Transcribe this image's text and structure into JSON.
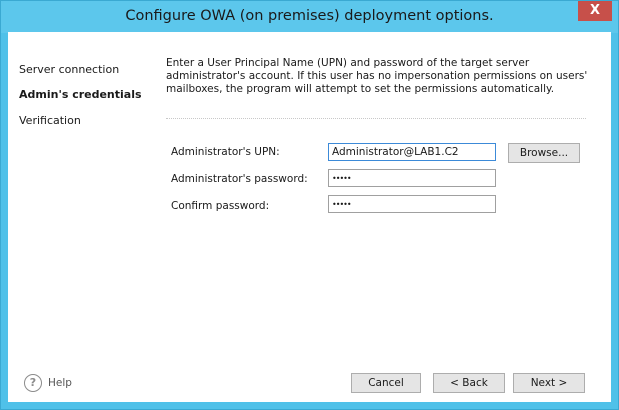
{
  "window": {
    "title": "Configure OWA (on premises) deployment options.",
    "close_glyph": "X"
  },
  "sidebar": {
    "items": [
      {
        "label": "Server connection",
        "active": false
      },
      {
        "label": "Admin's credentials",
        "active": true
      },
      {
        "label": "Verification",
        "active": false
      }
    ],
    "help_glyph": "?",
    "help_label": "Help"
  },
  "main": {
    "description": "Enter a User Principal Name (UPN) and password of the target server administrator's account. If this user has no impersonation permissions on users' mailboxes, the program will attempt to set the permissions automatically.",
    "fields": {
      "upn_label": "Administrator's UPN:",
      "upn_value": "Administrator@LAB1.C2",
      "password_label": "Administrator's password:",
      "password_value": "•••••",
      "confirm_label": "Confirm password:",
      "confirm_value": "•••••"
    },
    "browse_label": "Browse..."
  },
  "footer": {
    "cancel_label": "Cancel",
    "back_label": "< Back",
    "next_label": "Next >"
  },
  "colors": {
    "titlebar": "#5cc7ec",
    "close_button": "#c7504a",
    "focus_border": "#3c8ad8"
  }
}
